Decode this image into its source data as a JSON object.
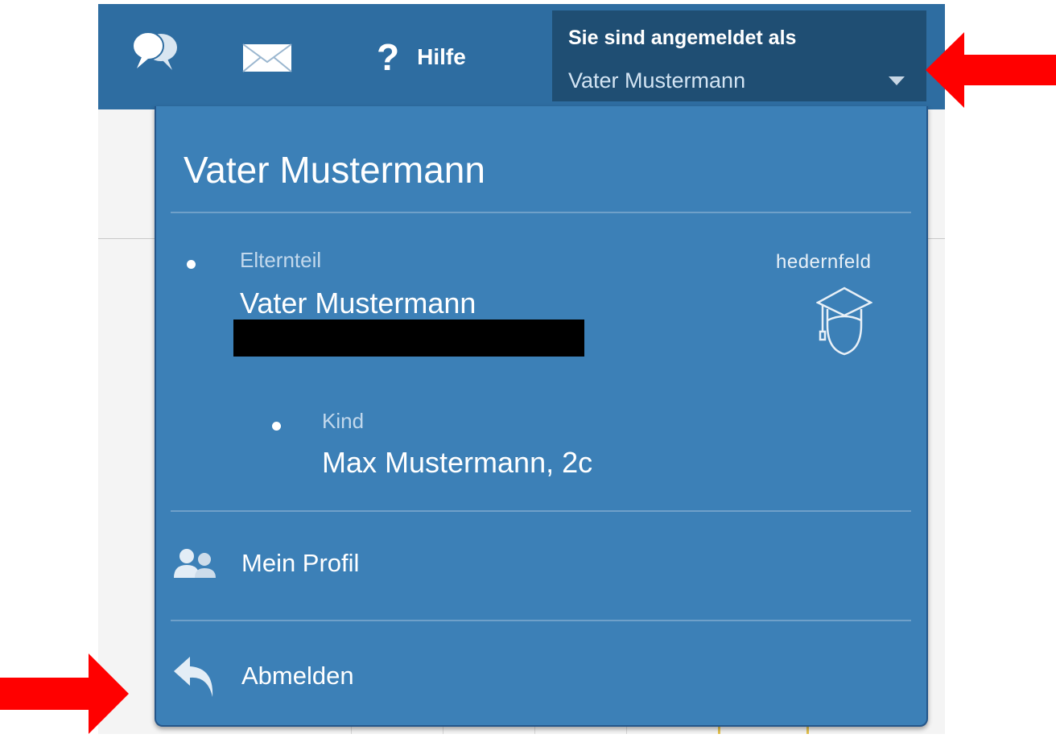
{
  "header": {
    "help_label": "Hilfe",
    "logged_in_label": "Sie sind angemeldet als",
    "logged_in_user": "Vater Mustermann"
  },
  "dropdown": {
    "title": "Vater Mustermann",
    "parent": {
      "role": "Elternteil",
      "name": "Vater Mustermann"
    },
    "school": "hedernfeld",
    "child": {
      "role": "Kind",
      "name": "Max Mustermann, 2c"
    },
    "items": [
      {
        "label": "Mein Profil",
        "icon": "users-icon"
      },
      {
        "label": "Abmelden",
        "icon": "reply-arrow-icon"
      }
    ]
  },
  "colors": {
    "topbar": "#2e6da1",
    "user_box": "#1f4e73",
    "menu": "#3c80b7",
    "annotation_arrow": "#ff0000"
  }
}
